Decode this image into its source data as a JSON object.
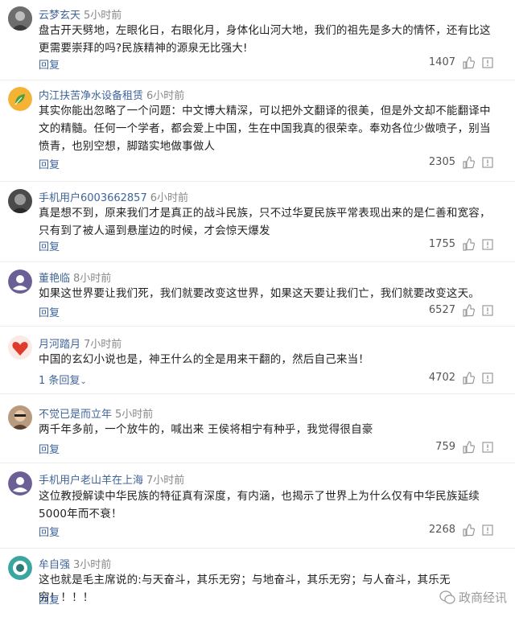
{
  "comments": [
    {
      "user": "云梦玄天",
      "time": "5小时前",
      "text": "盘古开天劈地，左眼化日，右眼化月，身体化山河大地，我们的祖先是多大的情怀，还有比这更需要崇拜的吗?民族精神的源泉无比强大!",
      "reply": "回复",
      "likes": "1407",
      "avatar_color": "#7a7a7a"
    },
    {
      "user": "内江扶苦净水设备租赁",
      "time": "6小时前",
      "text": "其实你能出忽略了一个问题：中文博大精深，可以把外文翻译的很美，但是外文却不能翻译中文的精髓。任何一个学者，都会爱上中国，生在中国我真的很荣幸。奉劝各位少做喷子，别当愤青，也别空想，脚踏实地做事做人",
      "reply": "回复",
      "likes": "2305",
      "avatar_color": "#f2a92e"
    },
    {
      "user": "手机用户6003662857",
      "time": "6小时前",
      "text": "真是想不到，原来我们才是真正的战斗民族，只不过华夏民族平常表现出来的是仁善和宽容，只有到了被人逼到悬崖边的时候，才会惊天爆发",
      "reply": "回复",
      "likes": "1755",
      "avatar_color": "#555555"
    },
    {
      "user": "董艳临",
      "time": "8小时前",
      "text": "如果这世界要让我们死，我们就要改变这世界，如果这天要让我们亡，我们就要改变这天。",
      "reply": "回复",
      "likes": "6527",
      "avatar_color": "#6b5f95"
    },
    {
      "user": "月河踏月",
      "time": "7小时前",
      "text": "中国的玄幻小说也是，神王什么的全是用来干翻的，然后自己来当！",
      "reply": "1 条回复",
      "likes": "4702",
      "avatar_color": "#e03a2a"
    },
    {
      "user": "不觉已是而立年",
      "time": "5小时前",
      "text": "两千年多前，一个放牛的，喊出来 王侯将相宁有种乎，我觉得很自豪",
      "reply": "回复",
      "likes": "759",
      "avatar_color": "#8a6a50"
    },
    {
      "user": "手机用户老山羊在上海",
      "time": "7小时前",
      "text": "这位教授解读中华民族的特征真有深度，有内涵，也揭示了世界上为什么仅有中华民族延续5000年而不衰！",
      "reply": "回复",
      "likes": "2268",
      "avatar_color": "#6b5f95"
    },
    {
      "user": "牟自强",
      "time": "3小时前",
      "text": "这也就是毛主席说的:与天奋斗，其乐无穷；与地奋斗，其乐无穷；与人奋斗，其乐无穷！！！！",
      "reply": "回复",
      "likes": "",
      "avatar_color": "#3aa6a0"
    }
  ],
  "watermark": {
    "text": "政商经讯"
  }
}
